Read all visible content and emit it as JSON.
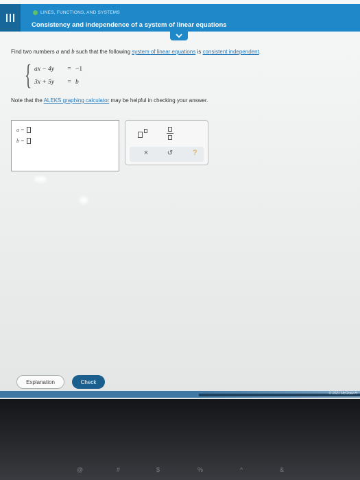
{
  "header": {
    "topic": "LINES, FUNCTIONS, AND SYSTEMS",
    "title": "Consistency and independence of a system of linear equations",
    "menu_icon": "menu-icon",
    "collapse_icon": "chevron-down-icon",
    "accent": "#1f88c9"
  },
  "question": {
    "prompt_pre": "Find two numbers",
    "var_a": "a",
    "prompt_and": "and",
    "var_b": "b",
    "prompt_mid": "such that the following",
    "link_system": "system of linear equations",
    "prompt_is": "is",
    "link_consistent": "consistent independent",
    "prompt_end": ".",
    "equations": [
      {
        "lhs": "ax − 4y",
        "rel": "=",
        "rhs": "−1"
      },
      {
        "lhs": "3x + 5y",
        "rel": "=",
        "rhs": "b"
      }
    ],
    "note_pre": "Note that the",
    "note_link": "ALEKS graphing calculator",
    "note_post": "may be helpful in checking your answer."
  },
  "answer": {
    "a_label": "a =",
    "b_label": "b ="
  },
  "tools": {
    "superscript_icon": "superscript-icon",
    "fraction_icon": "fraction-icon",
    "clear_label": "×",
    "undo_label": "↺",
    "help_label": "?"
  },
  "actions": {
    "explanation_label": "Explanation",
    "check_label": "Check",
    "check_color": "#1a5f8e"
  },
  "footer": {
    "text": "© 2021 McGraw-H"
  },
  "keyboard": {
    "keys": [
      "@",
      "#",
      "$",
      "%",
      "^",
      "&"
    ]
  }
}
